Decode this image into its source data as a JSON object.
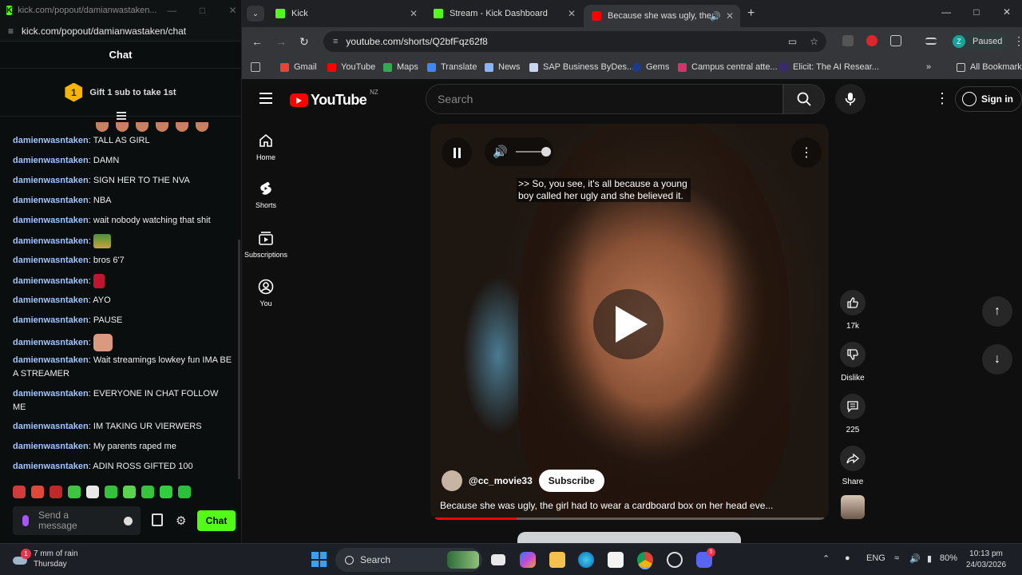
{
  "kick": {
    "window_title": "kick.com/popout/damianwastaken...",
    "url": "kick.com/popout/damianwastaken/chat",
    "chat_header": "Chat",
    "gift_rank": "1",
    "gift_text": "Gift 1 sub to take 1st",
    "username": "damienwasntaken",
    "messages": [
      {
        "text": "TALL AS GIRL"
      },
      {
        "text": "DAMN"
      },
      {
        "text": "SIGN HER TO THE NVA"
      },
      {
        "text": "NBA"
      },
      {
        "text": "wait nobody watching that shit"
      },
      {
        "text": "",
        "emote": "sunglasses-emote"
      },
      {
        "text": "bros 6'7"
      },
      {
        "text": "",
        "emote": "lips-emote"
      },
      {
        "text": "AYO"
      },
      {
        "text": "PAUSE"
      },
      {
        "text": "",
        "emote": "face-emote"
      },
      {
        "text": "Wait streamings lowkey fun IMA BE A STREAMER"
      },
      {
        "text": "EVERYONE IN CHAT FOLLOW ME"
      },
      {
        "text": "IM TAKING UR VIERWERS"
      },
      {
        "text": "My parents raped me"
      },
      {
        "text": "ADIN ROSS GIFTED 100"
      }
    ],
    "input_placeholder": "Send a message",
    "chat_button": "Chat"
  },
  "chrome": {
    "tabs": [
      {
        "label": "Kick",
        "icon": "kick-favicon"
      },
      {
        "label": "Stream - Kick Dashboard",
        "icon": "kick-favicon"
      },
      {
        "label": "Because she was ugly, the c",
        "icon": "youtube-favicon",
        "active": true
      }
    ],
    "url": "youtube.com/shorts/Q2bfFqz62f8",
    "profile_initial": "Z",
    "profile_status": "Paused",
    "bookmarks": [
      "Gmail",
      "YouTube",
      "Maps",
      "Translate",
      "News",
      "SAP Business ByDes...",
      "Gems",
      "Campus central atte...",
      "Elicit: The AI Resear..."
    ],
    "all_bookmarks": "All Bookmarks"
  },
  "youtube": {
    "logo_text": "YouTube",
    "region": "NZ",
    "search_placeholder": "Search",
    "sign_in": "Sign in",
    "sidebar": [
      {
        "label": "Home",
        "icon": "home-icon"
      },
      {
        "label": "Shorts",
        "icon": "shorts-icon"
      },
      {
        "label": "Subscriptions",
        "icon": "subscriptions-icon"
      },
      {
        "label": "You",
        "icon": "you-icon"
      }
    ],
    "caption": ">> So, you see, it's all because a young boy called her ugly and she believed it.",
    "channel": "@cc_movie33",
    "subscribe": "Subscribe",
    "title": "Because she was ugly, the girl had to wear a cardboard box on her head eve...",
    "progress": 0.21,
    "likes": "17k",
    "dislike": "Dislike",
    "comments": "225",
    "share": "Share"
  },
  "taskbar": {
    "weather": "7 mm of rain",
    "weather_day": "Thursday",
    "weather_badge": "1",
    "search": "Search",
    "language": "ENG",
    "battery": "80%",
    "time": "10:13 pm",
    "date": "24/03/2026",
    "discord_badge": "5"
  },
  "colors": {
    "kick_green": "#53fc18",
    "youtube_red": "#ff0000",
    "username_blue": "#9fc5ff"
  }
}
